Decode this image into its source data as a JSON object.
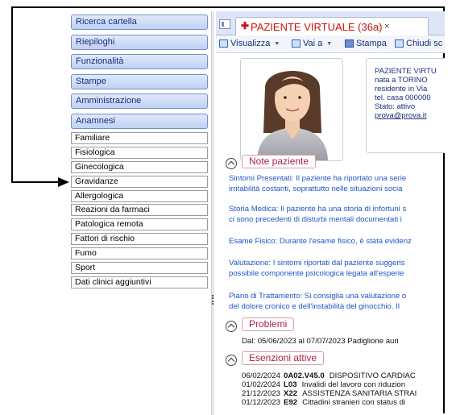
{
  "left_nav": {
    "main_buttons": [
      "Ricerca cartella",
      "Riepiloghi",
      "Funzionalità",
      "Stampe",
      "Amministrazione",
      "Anamnesi"
    ],
    "anamnesi_items": [
      "Familiare",
      "Fisiologica",
      "Ginecologica",
      "Gravidanze",
      "Allergologica",
      "Reazioni da farmaci",
      "Patologica remota",
      "Fattori di rischio",
      "Fumo",
      "Sport",
      "Dati clinici aggiuntivi"
    ]
  },
  "tab": {
    "title": "PAZIENTE VIRTUALE (36a)",
    "close": "×"
  },
  "toolbar": {
    "visualizza": "Visualizza",
    "vai_a": "Vai a",
    "stampa": "Stampa",
    "chiudi": "Chiudi sc"
  },
  "patient": {
    "name": "PAZIENTE VIRTU",
    "born": "nata a TORINO",
    "residence": "residente in Via",
    "phone": "tel. casa 000000",
    "status": "Stato: attivo",
    "email": "prova@prova.it"
  },
  "sections": {
    "notes_label": "Note paziente",
    "problems_label": "Problemi",
    "exemptions_label": "Esenzioni attive"
  },
  "notes": [
    "Sintomi Presentati: Il paziente ha riportato una serie",
    "irritabilità costanti, soprattutto nelle situazioni socia",
    "Storia Medica: Il paziente ha una storia di infortuni s",
    "ci sono precedenti di disturbi mentali documentati i",
    "Esame Fisico: Durante l'esame fisico, è stata evidenz",
    "Valutazione: I sintomi riportati dal paziente suggeris",
    "possibile componente psicologica legata all'esperie",
    "Piano di Trattamento: Si consiglia una valutazione o",
    "del dolore cronico e dell'instabilità del ginocchio. Il"
  ],
  "problem": "Dal: 05/06/2023   al 07/07/2023   Padiglione auri",
  "exemptions": [
    {
      "date": "06/02/2024",
      "code": "0A02.V45.0",
      "desc": "DISPOSITIVO CARDIAC"
    },
    {
      "date": "01/02/2024",
      "code": "L03",
      "desc": "Invalidi del lavoro con riduzion"
    },
    {
      "date": "21/12/2023",
      "code": "X22",
      "desc": "ASSISTENZA SANITARIA STRAI"
    },
    {
      "date": "01/12/2023",
      "code": "E92",
      "desc": "Cittadini stranieri con status di"
    }
  ]
}
